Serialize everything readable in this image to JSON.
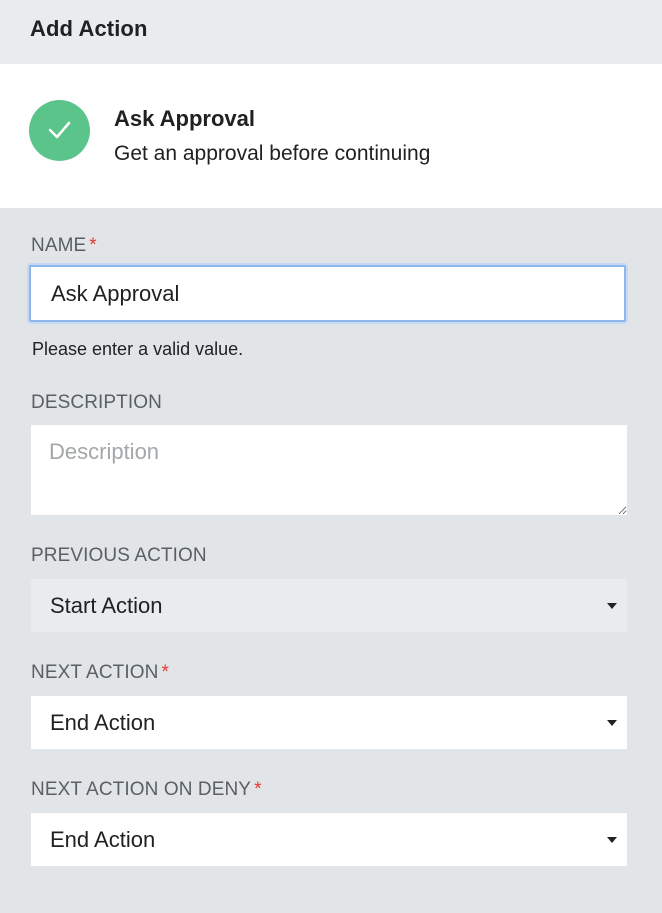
{
  "header": {
    "title": "Add Action"
  },
  "action_card": {
    "icon": "check-icon",
    "icon_color": "#5ac48b",
    "title": "Ask Approval",
    "subtitle": "Get an approval before continuing"
  },
  "form": {
    "name": {
      "label": "NAME",
      "required_mark": "*",
      "value": "Ask Approval",
      "helper": "Please enter a valid value."
    },
    "description": {
      "label": "DESCRIPTION",
      "placeholder": "Description",
      "value": ""
    },
    "previous_action": {
      "label": "PREVIOUS ACTION",
      "value": "Start Action"
    },
    "next_action": {
      "label": "NEXT ACTION",
      "required_mark": "*",
      "value": "End Action"
    },
    "next_action_on_deny": {
      "label": "NEXT ACTION ON DENY",
      "required_mark": "*",
      "value": "End Action"
    }
  },
  "colors": {
    "required": "#e53935",
    "focus_border": "#8fb6ea",
    "panel_background": "#e1e5e8"
  }
}
